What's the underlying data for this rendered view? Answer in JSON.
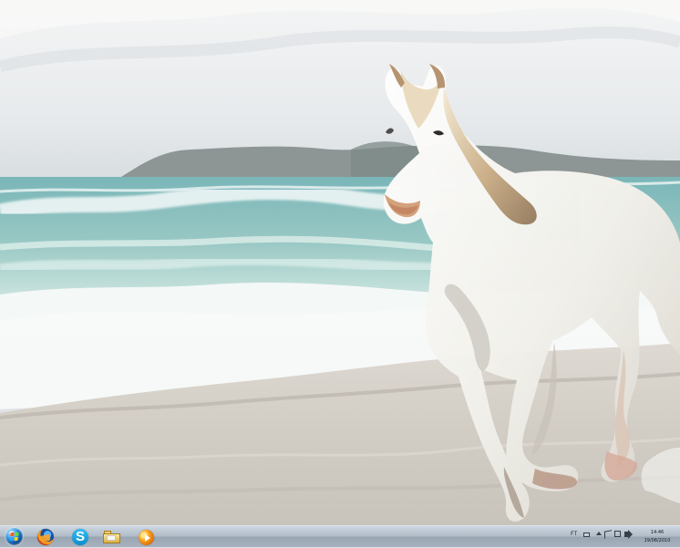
{
  "desktop": {
    "wallpaper": {
      "subject": "white horse running on a beach",
      "sky_color": "#e9ecef",
      "sea_color": "#74b8b6",
      "sand_color": "#dcd7ce",
      "horse_color": "#f2f0ea"
    }
  },
  "taskbar": {
    "start_icon": "windows-start-orb-icon",
    "pinned_items": [
      {
        "name": "firefox",
        "icon": "firefox-icon"
      },
      {
        "name": "skype",
        "icon": "skype-icon",
        "glyph": "S"
      },
      {
        "name": "windows-explorer",
        "icon": "folder-icon"
      },
      {
        "name": "media-player",
        "icon": "media-player-icon"
      }
    ],
    "tray": {
      "language": "FT",
      "icons": [
        "keyboard-icon",
        "show-hidden-icons-icon",
        "action-center-flag-icon",
        "network-icon",
        "volume-icon"
      ],
      "time": "14:46",
      "date": "19/08/2010"
    },
    "colors": {
      "taskbar_top": "#cdd6e0",
      "taskbar_bottom": "#a6b1bd",
      "icon_dark": "#34404a"
    }
  }
}
